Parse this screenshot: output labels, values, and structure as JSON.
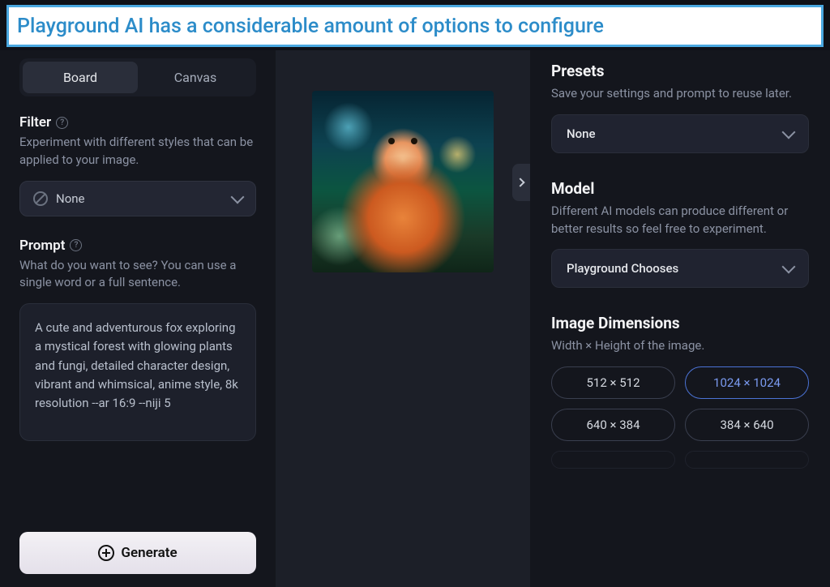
{
  "banner": {
    "text": "Playground AI has a considerable amount of options to configure"
  },
  "left": {
    "tabs": {
      "board": "Board",
      "canvas": "Canvas"
    },
    "filter": {
      "title": "Filter",
      "desc": "Experiment with different styles that can be applied to your image.",
      "value": "None"
    },
    "prompt": {
      "title": "Prompt",
      "desc": "What do you want to see? You can use a single word or a full sentence.",
      "value": "A cute and adventurous fox exploring a mystical forest with glowing plants and fungi, detailed character design, vibrant and whimsical, anime style, 8k resolution --ar 16:9 --niji 5"
    },
    "generate_label": "Generate"
  },
  "right": {
    "presets": {
      "title": "Presets",
      "desc": "Save your settings and prompt to reuse later.",
      "value": "None"
    },
    "model": {
      "title": "Model",
      "desc": "Different AI models can produce different or better results so feel free to experiment.",
      "value": "Playground Chooses"
    },
    "dimensions": {
      "title": "Image Dimensions",
      "desc": "Width × Height of the image.",
      "options": [
        "512 × 512",
        "1024 × 1024",
        "640 × 384",
        "384 × 640"
      ],
      "selected_index": 1
    }
  }
}
